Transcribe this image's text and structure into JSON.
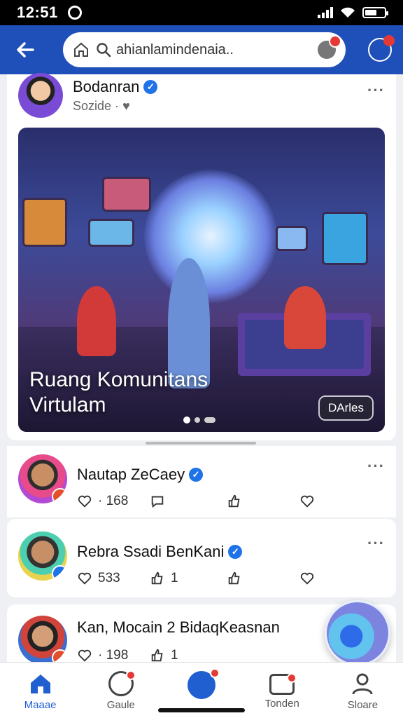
{
  "status_bar": {
    "time": "12:51"
  },
  "header": {
    "search_value": "ahianlamindenaia..",
    "search_placeholder": "ahianlamindenaia.."
  },
  "feed": {
    "top_post": {
      "author": "Bodanran",
      "subtitle": "Sozide ·",
      "hero_title_line1": "Ruang Komunitans",
      "hero_title_line2": "Virtulam",
      "hero_pill": "DArles"
    },
    "posts": [
      {
        "author": "Nautap ZeCaey",
        "likes": "· 168"
      },
      {
        "author": "Rebra Ssadi BenKani",
        "likes": "533",
        "shares": "1"
      },
      {
        "author": "Kan, Mocain 2 BidaqKeasnan",
        "likes": "· 198",
        "shares": "1"
      }
    ]
  },
  "bottom_nav": {
    "items": [
      {
        "label": "Maaae"
      },
      {
        "label": "Gaule"
      },
      {
        "label": ""
      },
      {
        "label": "Tonden"
      },
      {
        "label": "Sloare"
      }
    ]
  },
  "colors": {
    "brand": "#1f4fb8",
    "accent": "#1e73e8",
    "badge": "#e53935"
  }
}
